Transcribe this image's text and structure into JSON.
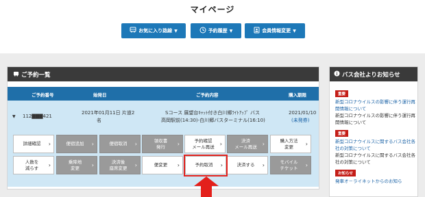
{
  "page": {
    "title": "マイページ"
  },
  "nav": [
    {
      "icon": "bus-icon",
      "label": "お気に入り路線"
    },
    {
      "icon": "clock-icon",
      "label": "予約履歴"
    },
    {
      "icon": "id-card-icon",
      "label": "会員情報変更"
    }
  ],
  "reservations": {
    "heading": "ご予約一覧",
    "columns": [
      "ご予約番号",
      "始発日",
      "ご予約内容",
      "購入期限"
    ],
    "row": {
      "number": "112▇▇▇421",
      "date_line1": "2021年01月11日 片道2",
      "date_line2": "名",
      "content_line1": "Sコース 展望台ｷｬｯﾄ付き白川郷ﾗｲﾄｱｯﾌﾟ バス",
      "content_line2": "高岡駅前(14:30)-白川郷バスターミナル(16:10)",
      "deadline_line1": "2021/01/10",
      "deadline_line2": "(未発券)"
    },
    "buttons": [
      {
        "line1": "詳細確認",
        "line2": "",
        "disabled": false
      },
      {
        "line1": "便宿追加",
        "line2": "",
        "disabled": true
      },
      {
        "line1": "便宿取消",
        "line2": "",
        "disabled": true
      },
      {
        "line1": "領収書",
        "line2": "発行",
        "disabled": true
      },
      {
        "line1": "予約確認",
        "line2": "メール再送",
        "disabled": false
      },
      {
        "line1": "決済",
        "line2": "メール再送",
        "disabled": true
      },
      {
        "line1": "購入方法",
        "line2": "変更",
        "disabled": false
      },
      {
        "line1": "人数を",
        "line2": "減らす",
        "disabled": false
      },
      {
        "line1": "乗降地",
        "line2": "変更",
        "disabled": true
      },
      {
        "line1": "決済後",
        "line2": "座席変更",
        "disabled": true
      },
      {
        "line1": "便変更",
        "line2": "",
        "disabled": false
      },
      {
        "line1": "予約取消",
        "line2": "",
        "disabled": false
      },
      {
        "line1": "決済する",
        "line2": "",
        "disabled": false
      },
      {
        "line1": "モバイル",
        "line2": "チケット",
        "disabled": true
      }
    ]
  },
  "news": {
    "heading": "バス会社よりお知らせ",
    "items": [
      {
        "badge": "重要",
        "link": "新型コロナウイルスの影響に伴う運行再開情報について",
        "text": "新型コロナウイルスの影響に伴う運行再開情報について"
      },
      {
        "badge": "重要",
        "link": "新型コロナウイルスに関するバス会社各社の対策について",
        "text": "新型コロナウイルスに関するバス会社各社の対策について"
      },
      {
        "badge": "お知らせ",
        "link": "発車オ－ライネットからのお知ら",
        "text": ""
      }
    ]
  },
  "colors": {
    "nav_blue": "#1d78b8",
    "table_head": "#1f6fa9",
    "row_bg": "#cfe7f5",
    "highlight_red": "#e3201b",
    "badge_red": "#c41d17",
    "link_blue": "#1a62a6"
  }
}
